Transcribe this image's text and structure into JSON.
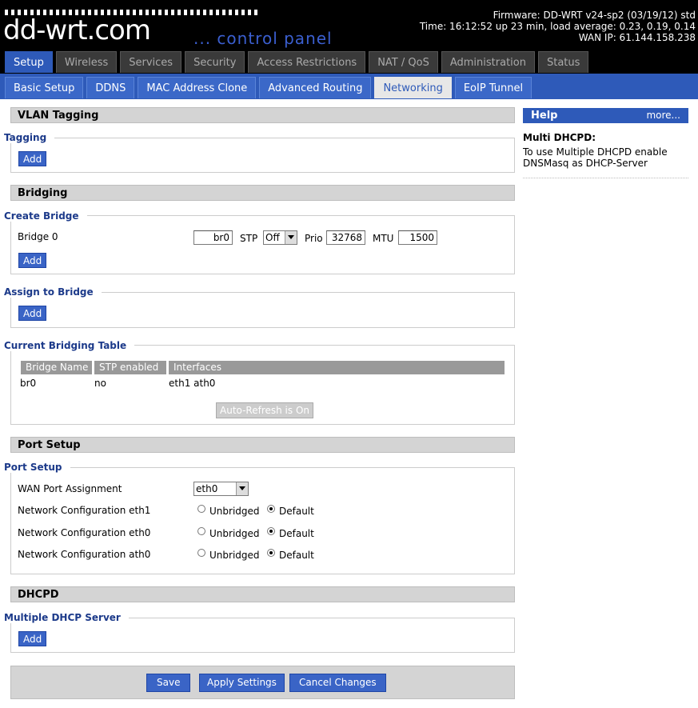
{
  "header": {
    "logo_text": "dd-wrt.com",
    "subtitle": "... control panel",
    "firmware": "Firmware: DD-WRT v24-sp2 (03/19/12) std",
    "time": "Time: 16:12:52 up 23 min, load average: 0.23, 0.19, 0.14",
    "wan_ip": "WAN IP: 61.144.158.238"
  },
  "main_tabs": [
    "Setup",
    "Wireless",
    "Services",
    "Security",
    "Access Restrictions",
    "NAT / QoS",
    "Administration",
    "Status"
  ],
  "sub_tabs": [
    "Basic Setup",
    "DDNS",
    "MAC Address Clone",
    "Advanced Routing",
    "Networking",
    "EoIP Tunnel"
  ],
  "vlan": {
    "title": "VLAN Tagging",
    "legend": "Tagging",
    "add": "Add"
  },
  "bridging": {
    "title": "Bridging",
    "create_legend": "Create Bridge",
    "bridge_label": "Bridge 0",
    "bridge_name": "br0",
    "stp_label": "STP",
    "stp_value": "Off",
    "prio_label": "Prio",
    "prio_value": "32768",
    "mtu_label": "MTU",
    "mtu_value": "1500",
    "add": "Add",
    "assign_legend": "Assign to Bridge",
    "assign_add": "Add",
    "table_legend": "Current Bridging Table",
    "table_headers": [
      "Bridge Name",
      "STP enabled",
      "Interfaces"
    ],
    "table_row": [
      "br0",
      "no",
      "eth1 ath0"
    ],
    "autorefresh": "Auto-Refresh is On"
  },
  "port_setup": {
    "title": "Port Setup",
    "legend": "Port Setup",
    "wan_label": "WAN Port Assignment",
    "wan_value": "eth0",
    "rows": [
      {
        "label": "Network Configuration eth1",
        "opt1": "Unbridged",
        "opt2": "Default"
      },
      {
        "label": "Network Configuration eth0",
        "opt1": "Unbridged",
        "opt2": "Default"
      },
      {
        "label": "Network Configuration ath0",
        "opt1": "Unbridged",
        "opt2": "Default"
      }
    ]
  },
  "dhcpd": {
    "title": "DHCPD",
    "legend": "Multiple DHCP Server",
    "add": "Add"
  },
  "buttons": {
    "save": "Save",
    "apply": "Apply Settings",
    "cancel": "Cancel Changes"
  },
  "help": {
    "head": "Help",
    "more": "more...",
    "title": "Multi DHCPD:",
    "text": "To use Multiple DHCPD enable DNSMasq as DHCP-Server"
  }
}
